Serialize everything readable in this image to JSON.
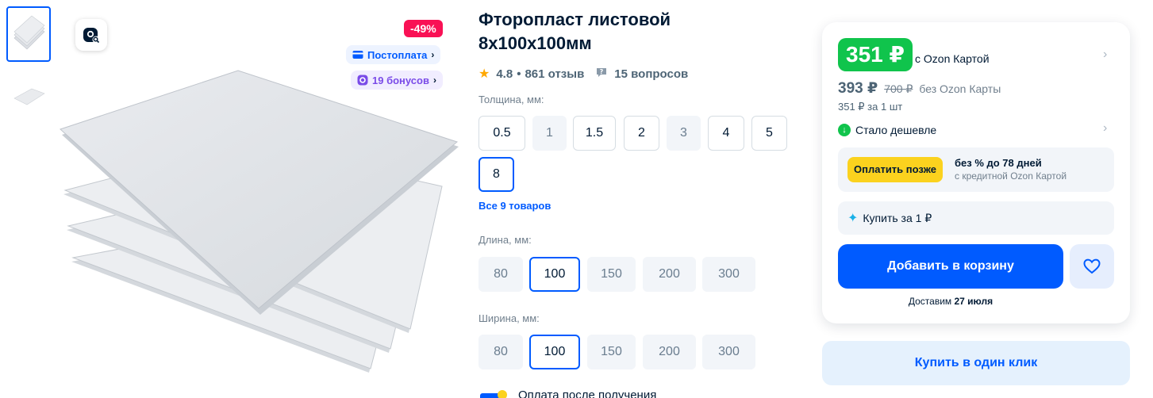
{
  "gallery": {
    "discount": "-49%",
    "postpay_label": "Постоплата",
    "bonus_label": "19 бонусов"
  },
  "product": {
    "title": "Фторопласт листовой 8х100х100мм",
    "rating": "4.8",
    "separator": "•",
    "reviews": "861 отзыв",
    "questions": "15 вопросов"
  },
  "thickness": {
    "label": "Толщина, мм:",
    "options": [
      "0.5",
      "1",
      "1.5",
      "2",
      "3",
      "4",
      "5",
      "8"
    ],
    "selected": "8"
  },
  "all_items_link": "Все 9 товаров",
  "length": {
    "label": "Длина, мм:",
    "options": [
      "80",
      "100",
      "150",
      "200",
      "300"
    ],
    "selected": "100"
  },
  "width": {
    "label": "Ширина, мм:",
    "options": [
      "80",
      "100",
      "150",
      "200",
      "300"
    ],
    "selected": "100"
  },
  "payment_note": "Оплата после получения",
  "price_card": {
    "price_ozon": "351 ₽",
    "price_ozon_note": "с Ozon Картой",
    "price_regular": "393 ₽",
    "price_old": "700 ₽",
    "price_regular_note": "без Ozon Карты",
    "per_unit": "351 ₽ за 1 шт",
    "cheaper_label": "Стало дешевле",
    "pay_later_button": "Оплатить позже",
    "pay_later_title": "без % до 78 дней",
    "pay_later_subtitle": "с кредитной Ozon Картой",
    "buy_for_1": "Купить за 1 ₽",
    "add_to_cart": "Добавить в корзину",
    "delivery_prefix": "Доставим",
    "delivery_date": "27 июля",
    "buy_one_click": "Купить в один клик"
  },
  "colors": {
    "accent": "#005bff",
    "price_green": "#10c44c",
    "discount_pink": "#f91155",
    "pay_later_yellow": "#fbd21e"
  }
}
